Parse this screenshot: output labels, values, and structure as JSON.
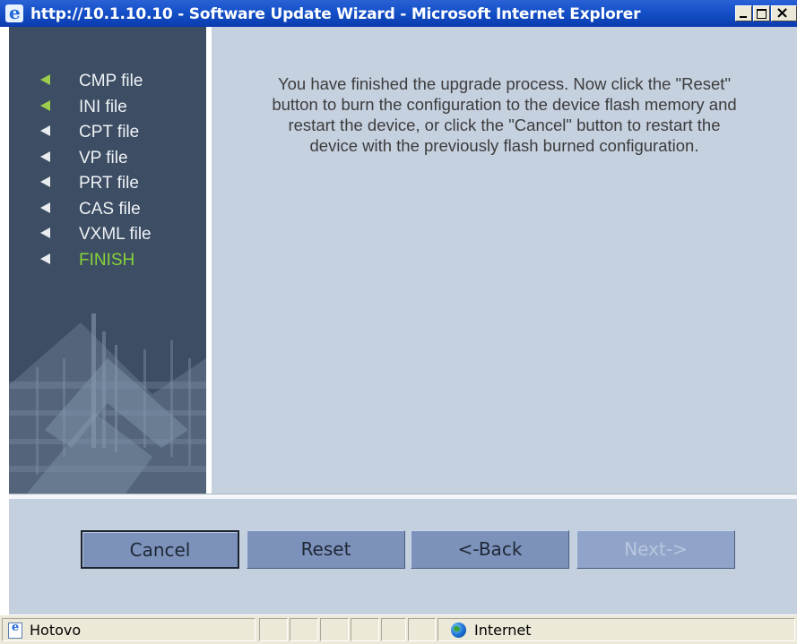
{
  "window": {
    "title": "http://10.1.10.10 - Software Update Wizard - Microsoft Internet Explorer"
  },
  "sidebar": {
    "steps": [
      {
        "label": "CMP file",
        "status": "done"
      },
      {
        "label": "INI file",
        "status": "done"
      },
      {
        "label": "CPT file",
        "status": "pending"
      },
      {
        "label": "VP file",
        "status": "pending"
      },
      {
        "label": "PRT file",
        "status": "pending"
      },
      {
        "label": "CAS file",
        "status": "pending"
      },
      {
        "label": "VXML file",
        "status": "pending"
      },
      {
        "label": "FINISH",
        "status": "active"
      }
    ]
  },
  "content": {
    "message_lines": [
      "You have finished the upgrade process. Now click the \"Reset\"",
      "button to burn the configuration to the device flash memory and",
      "restart the device, or click the \"Cancel\" button to restart the",
      "device with the previously flash burned configuration."
    ]
  },
  "buttons": {
    "cancel": "Cancel",
    "reset": "Reset",
    "back": "<-Back",
    "next": "Next->"
  },
  "statusbar": {
    "status_text": "Hotovo",
    "zone": "Internet"
  },
  "icons": {
    "title_icon": "internet-explorer-icon",
    "step_pending": "white-arrow-icon",
    "step_done": "green-arrow-icon",
    "status_icon": "page-icon",
    "zone_icon": "globe-icon"
  },
  "colors": {
    "sidebar_bg": "#3d4d63",
    "content_bg": "#c6d1e0",
    "active_step": "#86d43a",
    "button_bg": "#7c92ba",
    "titlebar": "#1450c8"
  }
}
